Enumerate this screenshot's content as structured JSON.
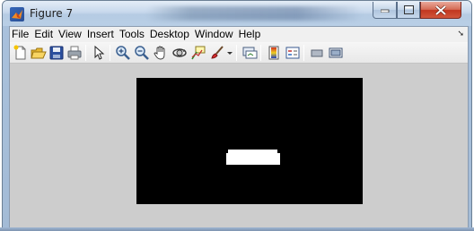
{
  "window": {
    "title": "Figure 7",
    "controls": {
      "minimize": "minimize",
      "maximize": "maximize",
      "close": "close"
    }
  },
  "menubar": {
    "items": [
      "File",
      "Edit",
      "View",
      "Insert",
      "Tools",
      "Desktop",
      "Window",
      "Help"
    ],
    "overflow_arrow": "➘"
  },
  "toolbar": {
    "buttons": [
      {
        "name": "new-figure-icon"
      },
      {
        "name": "open-file-icon"
      },
      {
        "name": "save-figure-icon"
      },
      {
        "name": "print-figure-icon"
      },
      {
        "name": "edit-plot-arrow-icon"
      },
      {
        "name": "zoom-in-icon"
      },
      {
        "name": "zoom-out-icon"
      },
      {
        "name": "pan-hand-icon"
      },
      {
        "name": "rotate-3d-icon"
      },
      {
        "name": "data-cursor-icon"
      },
      {
        "name": "brush-icon"
      },
      {
        "name": "brush-dropdown-icon"
      },
      {
        "name": "link-plot-icon"
      },
      {
        "name": "insert-colorbar-icon"
      },
      {
        "name": "insert-legend-icon"
      },
      {
        "name": "hide-plot-tools-icon"
      },
      {
        "name": "show-plot-tools-icon"
      }
    ]
  },
  "colors": {
    "axes_background": "#000000",
    "figure_background": "#cdcdcd",
    "foreground_blob": "#ffffff"
  }
}
